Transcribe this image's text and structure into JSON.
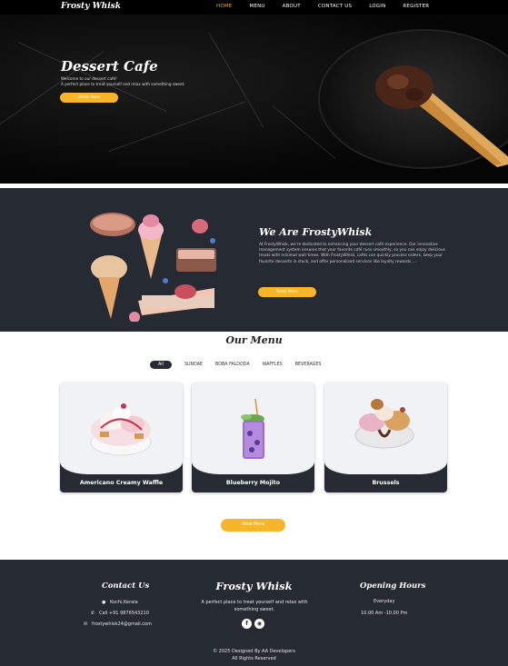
{
  "nav": {
    "brand": "Frosty Whisk",
    "items": [
      {
        "label": "HOME",
        "active": true
      },
      {
        "label": "MENU",
        "active": false
      },
      {
        "label": "ABOUT",
        "active": false
      },
      {
        "label": "CONTACT US",
        "active": false
      },
      {
        "label": "LOGIN",
        "active": false
      },
      {
        "label": "REGISTER",
        "active": false
      }
    ]
  },
  "hero": {
    "title": "Dessert Cafe",
    "line1": "Welcome to our dessert café!",
    "line2": "A perfect place to treat yourself and relax with something sweet.",
    "button": "Order Now"
  },
  "about": {
    "title": "We Are FrostyWhisk",
    "text": "At FrostyWhisk, we're dedicated to enhancing your dessert café experience. Our innovative management system ensures that your favorite café runs smoothly, so you can enjoy delicious treats with minimal wait times. With FrostyWhisk, cafés can quickly process orders, keep your favorite desserts in stock, and offer personalized services like loyalty rewards.....",
    "button": "Read More"
  },
  "menu": {
    "title": "Our Menu",
    "filters": [
      "All",
      "SUNDAE",
      "BOBA FALOODA",
      "WAFFLES",
      "BEVERAGES"
    ],
    "items": [
      {
        "name": "Americano Creamy Waffle"
      },
      {
        "name": "Blueberry Mojito"
      },
      {
        "name": "Brussels"
      }
    ],
    "view_more": "View More"
  },
  "footer": {
    "contact_title": "Contact Us",
    "location": "Kochi,Kerala",
    "phone": "Call +91 9876543210",
    "email": "frostywhisk24@gmail.com",
    "brand": "Frosty Whisk",
    "tagline": "A perfect place to treat yourself and relax with something sweet.",
    "hours_title": "Opening Hours",
    "hours_days": "Everyday",
    "hours_time": "10.00 Am -10.00 Pm",
    "copyright": "© 2025 Designed By AA Developers",
    "rights": "All Rights Reserved"
  },
  "colors": {
    "accent": "#f7b52a",
    "dark": "#262a33",
    "nav_active": "#f5a623"
  }
}
